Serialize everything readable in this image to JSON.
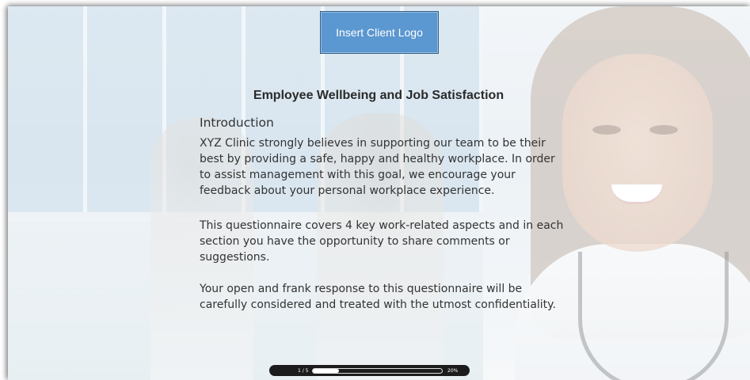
{
  "logo": {
    "label": "Insert Client Logo",
    "color": "#5b97d0"
  },
  "title": "Employee Wellbeing and Job Satisfaction",
  "intro": {
    "heading": "Introduction",
    "paragraphs": [
      "XYZ Clinic strongly believes in supporting our team to be their best by providing a safe, happy and healthy workplace. In order to assist management with this goal, we  encourage your feedback about your personal workplace experience.",
      "This questionnaire covers 4 key work-related aspects and in each section you have the opportunity to share comments or suggestions.",
      "Your open and frank response to this questionnaire will be carefully considered and treated with the utmost confidentiality."
    ]
  },
  "progress": {
    "page_label": "1 / 5",
    "percent_label": "20%",
    "fraction": 0.2
  },
  "background": {
    "image_icon": "doctor-photo-icon"
  }
}
